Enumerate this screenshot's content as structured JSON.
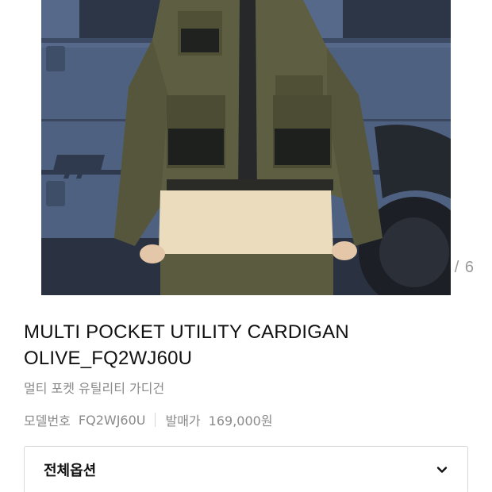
{
  "gallery": {
    "image_alt": "Model wearing olive multi pocket utility cardigan in front of a blue vehicle",
    "counter": "/ 6"
  },
  "product": {
    "title_line1": "MULTI POCKET UTILITY CARDIGAN",
    "title_line2": "OLIVE_FQ2WJ60U",
    "subtitle": "멀티 포켓 유틸리티 가디건",
    "model_label": "모델번호",
    "model_value": "FQ2WJ60U",
    "price_label": "발매가",
    "price_value": "169,000원"
  },
  "options": {
    "label": "전체옵션",
    "icon": "chevron-down-icon"
  },
  "colors": {
    "olive": "#5a5b3f",
    "vehicle_blue": "#4d5f7e",
    "shirt": "#e9dcbd"
  }
}
